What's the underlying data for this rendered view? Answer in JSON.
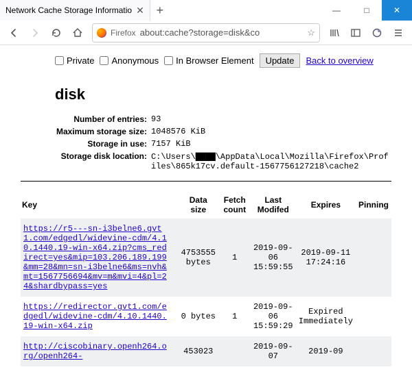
{
  "window": {
    "tab_title": "Network Cache Storage Informatio",
    "min": "—",
    "max": "□",
    "close": "✕"
  },
  "toolbar": {
    "firefox_label": "Firefox",
    "url": "about:cache?storage=disk&co"
  },
  "controls": {
    "private": "Private",
    "anonymous": "Anonymous",
    "inbrowser": "In Browser Element",
    "update": "Update",
    "back_link": "Back to overview"
  },
  "page": {
    "heading": "disk",
    "meta": {
      "entries_label": "Number of entries:",
      "entries_value": "93",
      "maxsize_label": "Maximum storage size:",
      "maxsize_value": "1048576 KiB",
      "inuse_label": "Storage in use:",
      "inuse_value": "7157 KiB",
      "location_label": "Storage disk location:",
      "location_value": "C:\\Users\\▇▇▇▇\\AppData\\Local\\Mozilla\\Firefox\\Profiles\\865k17cv.default-1567756127218\\cache2"
    }
  },
  "table": {
    "headers": {
      "key": "Key",
      "size": "Data size",
      "fetch": "Fetch count",
      "modified": "Last Modifed",
      "expires": "Expires",
      "pinning": "Pinning"
    },
    "rows": [
      {
        "key": "https://r5---sn-i3belne6.gvt1.com/edgedl/widevine-cdm/4.10.1440.19-win-x64.zip?cms_redirect=yes&mip=103.206.189.199&mm=28&mn=sn-i3belne6&ms=nvh&mt=1567756694&mv=m&mvi=4&pl=24&shardbypass=yes",
        "size": "4753555 bytes",
        "fetch": "1",
        "modified": "2019-09-06 15:59:55",
        "expires": "2019-09-11 17:24:16",
        "pinning": ""
      },
      {
        "key": "https://redirector.gvt1.com/edgedl/widevine-cdm/4.10.1440.19-win-x64.zip",
        "size": "0 bytes",
        "fetch": "1",
        "modified": "2019-09-06 15:59:29",
        "expires": "Expired Immediately",
        "pinning": ""
      },
      {
        "key": "http://ciscobinary.openh264.org/openh264-",
        "size": "453023",
        "fetch": "",
        "modified": "2019-09-07",
        "expires": "2019-09",
        "pinning": ""
      }
    ]
  }
}
